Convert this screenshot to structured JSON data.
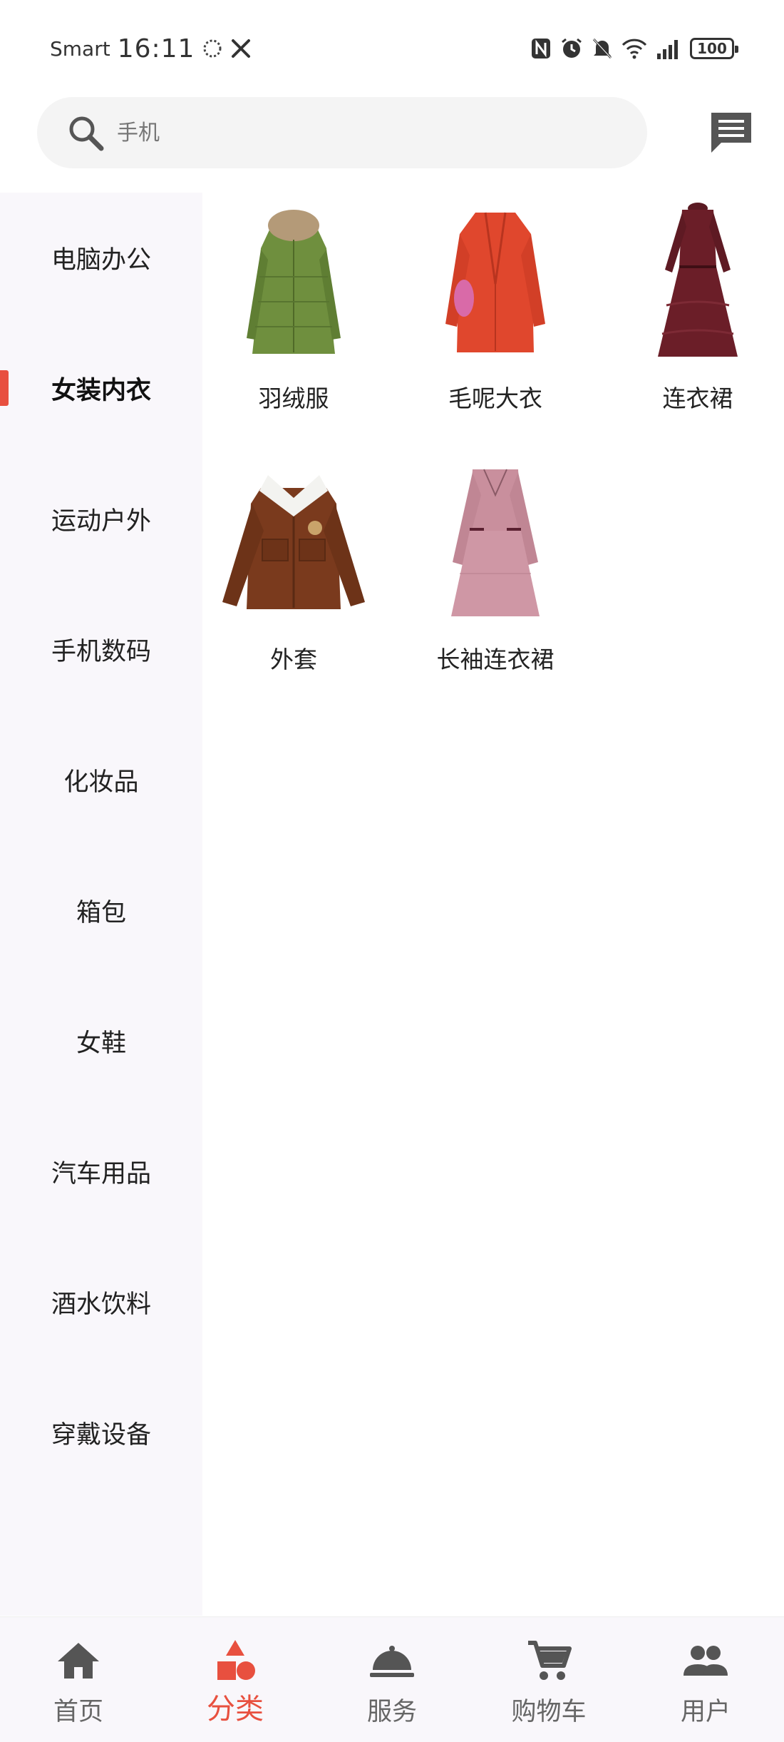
{
  "status_bar": {
    "carrier": "Smart",
    "time": "16:11",
    "battery": "100"
  },
  "search": {
    "placeholder": "手机"
  },
  "sidebar": {
    "items": [
      {
        "label": "电脑办公"
      },
      {
        "label": "女装内衣",
        "active": true
      },
      {
        "label": "运动户外"
      },
      {
        "label": "手机数码"
      },
      {
        "label": "化妆品"
      },
      {
        "label": "箱包"
      },
      {
        "label": "女鞋"
      },
      {
        "label": "汽车用品"
      },
      {
        "label": "酒水饮料"
      },
      {
        "label": "穿戴设备"
      }
    ]
  },
  "products": [
    {
      "name": "羽绒服",
      "image": "green-down-coat"
    },
    {
      "name": "毛呢大衣",
      "image": "red-wool-coat"
    },
    {
      "name": "连衣裙",
      "image": "lace-dress"
    },
    {
      "name": "外套",
      "image": "brown-jacket"
    },
    {
      "name": "长袖连衣裙",
      "image": "pink-long-sleeve-dress"
    }
  ],
  "bottom_nav": {
    "items": [
      {
        "label": "首页",
        "icon": "home-icon"
      },
      {
        "label": "分类",
        "icon": "category-icon",
        "active": true
      },
      {
        "label": "服务",
        "icon": "service-bell-icon"
      },
      {
        "label": "购物车",
        "icon": "cart-icon"
      },
      {
        "label": "用户",
        "icon": "users-icon"
      }
    ]
  },
  "colors": {
    "accent": "#e8503f",
    "sidebar_bg": "#f9f7fb",
    "search_bg": "#f4f4f4"
  }
}
